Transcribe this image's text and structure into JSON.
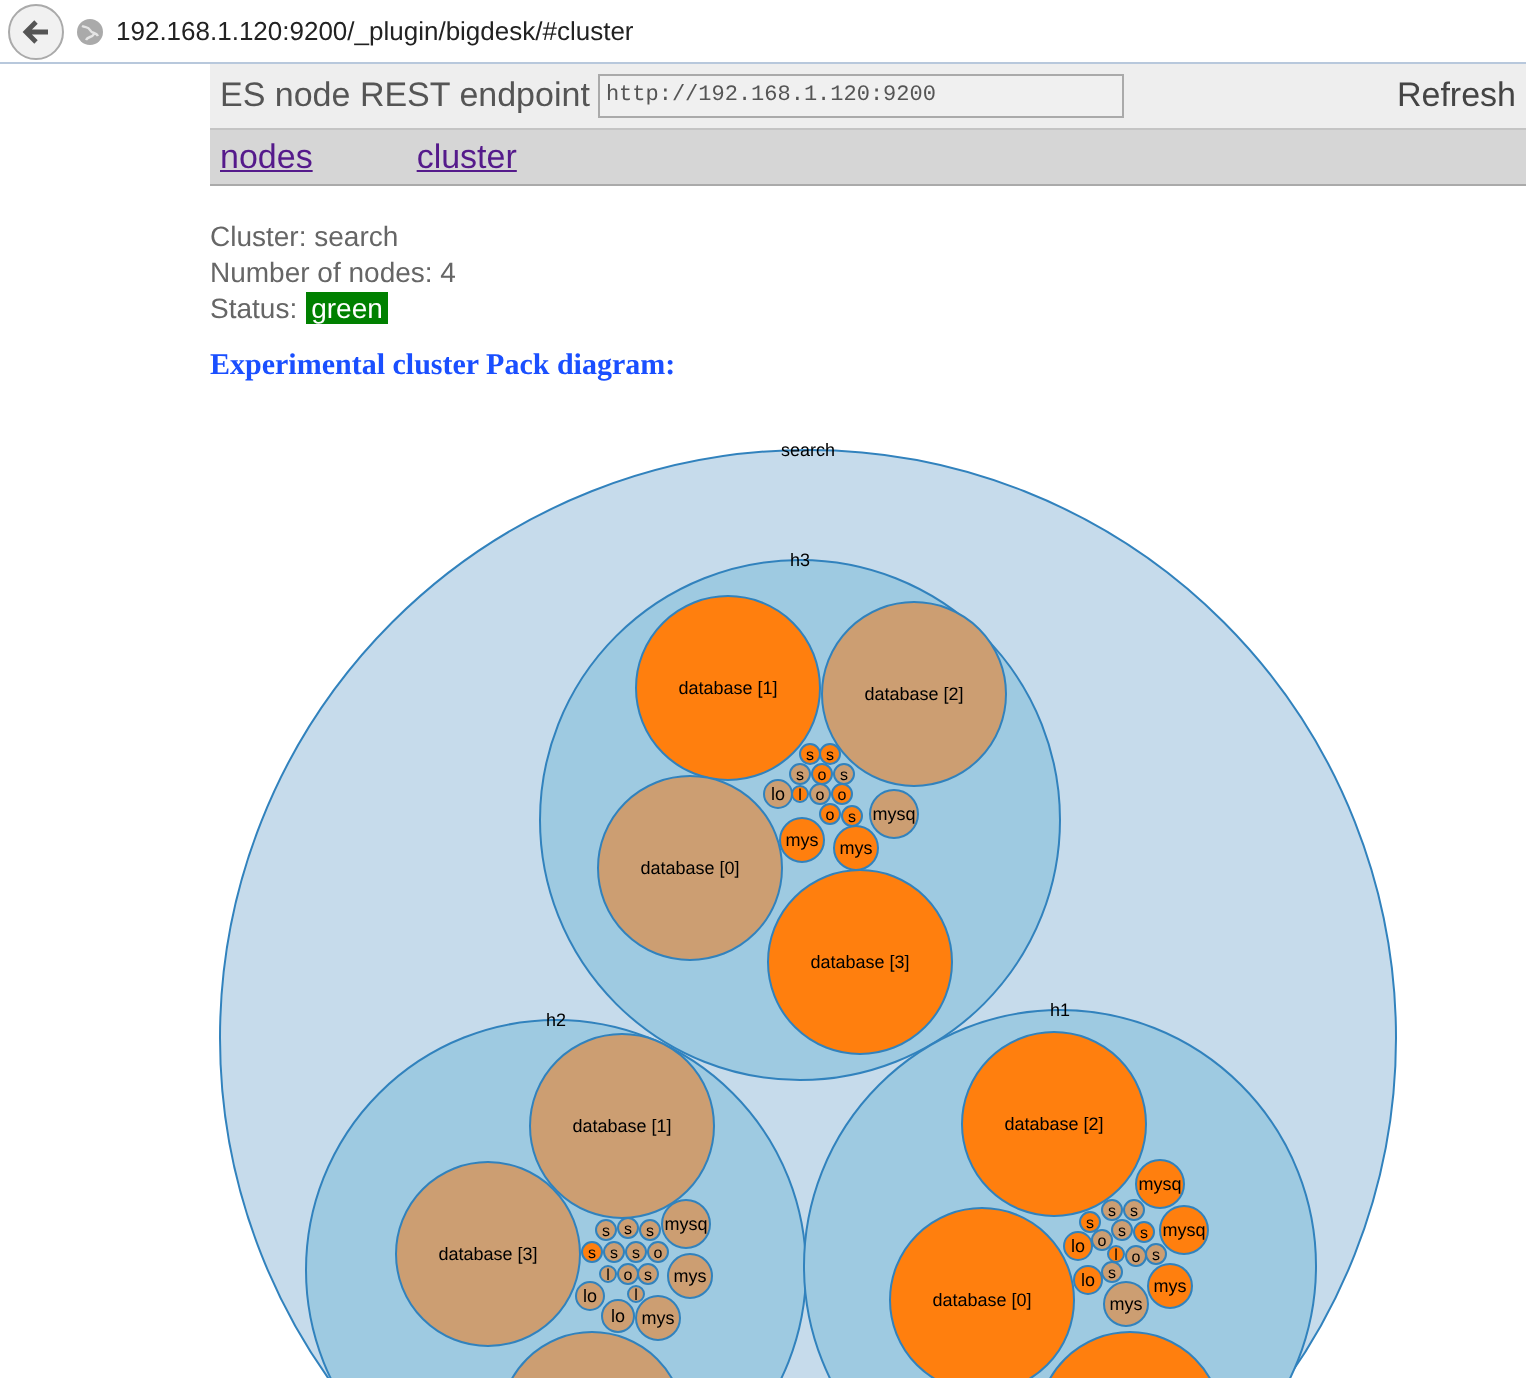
{
  "browser": {
    "url": "192.168.1.120:9200/_plugin/bigdesk/#cluster"
  },
  "header": {
    "endpoint_label": "ES node REST endpoint",
    "endpoint_value": "http://192.168.1.120:9200",
    "refresh": "Refresh"
  },
  "nav": [
    {
      "label": "nodes"
    },
    {
      "label": "cluster"
    }
  ],
  "info": {
    "cluster": "Cluster: search",
    "nodes": "Number of nodes: 4",
    "status_label": "Status:",
    "status": "green"
  },
  "diagram_title": "Experimental cluster Pack diagram:",
  "diagram": {
    "root": "search",
    "nodes": [
      {
        "name": "h3",
        "shards": [
          {
            "label": "database [1]",
            "primary": true
          },
          {
            "label": "database [2]",
            "primary": false
          },
          {
            "label": "s",
            "primary": true
          },
          {
            "label": "s",
            "primary": true
          },
          {
            "label": "s",
            "primary": false
          },
          {
            "label": "o",
            "primary": true
          },
          {
            "label": "s",
            "primary": false
          },
          {
            "label": "lo",
            "primary": false
          },
          {
            "label": "l",
            "primary": true
          },
          {
            "label": "o",
            "primary": false
          },
          {
            "label": "o",
            "primary": true
          },
          {
            "label": "o",
            "primary": true
          },
          {
            "label": "s",
            "primary": true
          },
          {
            "label": "mysq",
            "primary": false
          },
          {
            "label": "mys",
            "primary": true
          },
          {
            "label": "mys",
            "primary": true
          },
          {
            "label": "database [0]",
            "primary": false
          },
          {
            "label": "database [3]",
            "primary": true
          }
        ]
      },
      {
        "name": "h2",
        "shards": [
          {
            "label": "database [1]",
            "primary": false
          },
          {
            "label": "s",
            "primary": false
          },
          {
            "label": "s",
            "primary": false
          },
          {
            "label": "s",
            "primary": false
          },
          {
            "label": "mysq",
            "primary": false
          },
          {
            "label": "database [3]",
            "primary": false
          },
          {
            "label": "s",
            "primary": true
          },
          {
            "label": "s",
            "primary": false
          },
          {
            "label": "s",
            "primary": false
          },
          {
            "label": "o",
            "primary": false
          },
          {
            "label": "l",
            "primary": false
          },
          {
            "label": "o",
            "primary": false
          },
          {
            "label": "s",
            "primary": false
          },
          {
            "label": "mys",
            "primary": false
          },
          {
            "label": "lo",
            "primary": false
          },
          {
            "label": "l",
            "primary": false
          },
          {
            "label": "lo",
            "primary": false
          },
          {
            "label": "mys",
            "primary": false
          },
          {
            "primary": false
          }
        ]
      },
      {
        "name": "h1",
        "shards": [
          {
            "label": "database [2]",
            "primary": true
          },
          {
            "label": "mysq",
            "primary": true
          },
          {
            "label": "s",
            "primary": true
          },
          {
            "label": "s",
            "primary": false
          },
          {
            "label": "s",
            "primary": false
          },
          {
            "label": "s",
            "primary": false
          },
          {
            "label": "s",
            "primary": true
          },
          {
            "label": "mysq",
            "primary": true
          },
          {
            "label": "lo",
            "primary": true
          },
          {
            "label": "o",
            "primary": false
          },
          {
            "label": "l",
            "primary": true
          },
          {
            "label": "o",
            "primary": false
          },
          {
            "label": "s",
            "primary": false
          },
          {
            "label": "lo",
            "primary": true
          },
          {
            "label": "s",
            "primary": false
          },
          {
            "label": "database [0]",
            "primary": true
          },
          {
            "label": "mys",
            "primary": true
          },
          {
            "label": "mys",
            "primary": false
          },
          {
            "primary": true
          }
        ]
      }
    ]
  }
}
